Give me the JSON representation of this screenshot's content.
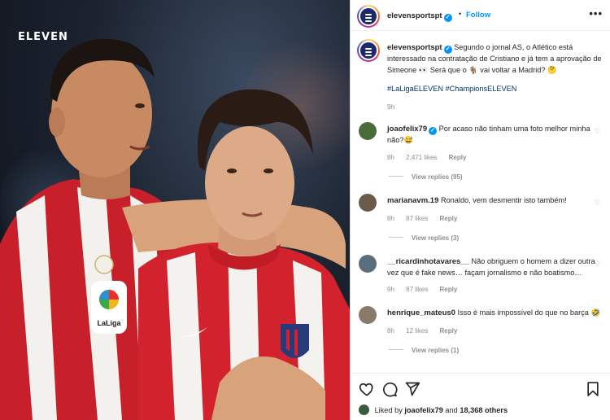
{
  "photo": {
    "brand_text": "ELEVEN"
  },
  "post": {
    "username": "elevensportspt",
    "follow_label": "Follow",
    "more_label": "•••",
    "caption": "Segundo o jornal AS, o Atlético está interessado na contratação de Cristiano e já tem a aprovação de Simeone 👀 Será que o 🐐 vai voltar a Madrid? 🤔",
    "hashtags": "#LaLigaELEVEN #ChampionsELEVEN",
    "time": "9h"
  },
  "comments": [
    {
      "user": "joaofelix79",
      "verified": true,
      "text": "Por acaso não tinham uma foto melhor minha não?😅",
      "time": "8h",
      "likes": "2,471 likes",
      "reply": "Reply",
      "view_replies": "View replies (95)",
      "avatar_color": "#4a6b3a"
    },
    {
      "user": "marianavm.19",
      "verified": false,
      "text": "Ronaldo, vem desmentir isto também!",
      "time": "8h",
      "likes": "87 likes",
      "reply": "Reply",
      "view_replies": "View replies (3)",
      "avatar_color": "#6b5a48"
    },
    {
      "user": "__ricardinhotavares__",
      "verified": false,
      "text": "Não obriguem o homem a dizer outra vez que é fake news… façam jornalismo e não boatismo…",
      "time": "9h",
      "likes": "87 likes",
      "reply": "Reply",
      "view_replies": "",
      "avatar_color": "#5a6e7e"
    },
    {
      "user": "henrique_mateus0",
      "verified": false,
      "text": "Isso é mais impossível do que no barça 🤣",
      "time": "8h",
      "likes": "12 likes",
      "reply": "Reply",
      "view_replies": "View replies (1)",
      "avatar_color": "#8a7a6a"
    }
  ],
  "liked_by": {
    "prefix": "Liked by",
    "user": "joaofelix79",
    "and": "and",
    "others": "18,368 others"
  },
  "icons": {
    "like": "heart-icon",
    "comment": "comment-icon",
    "share": "send-icon",
    "save": "bookmark-icon"
  },
  "colors": {
    "accent": "#0095f6",
    "hashtag": "#00376b",
    "atletico_red": "#d2222d"
  }
}
